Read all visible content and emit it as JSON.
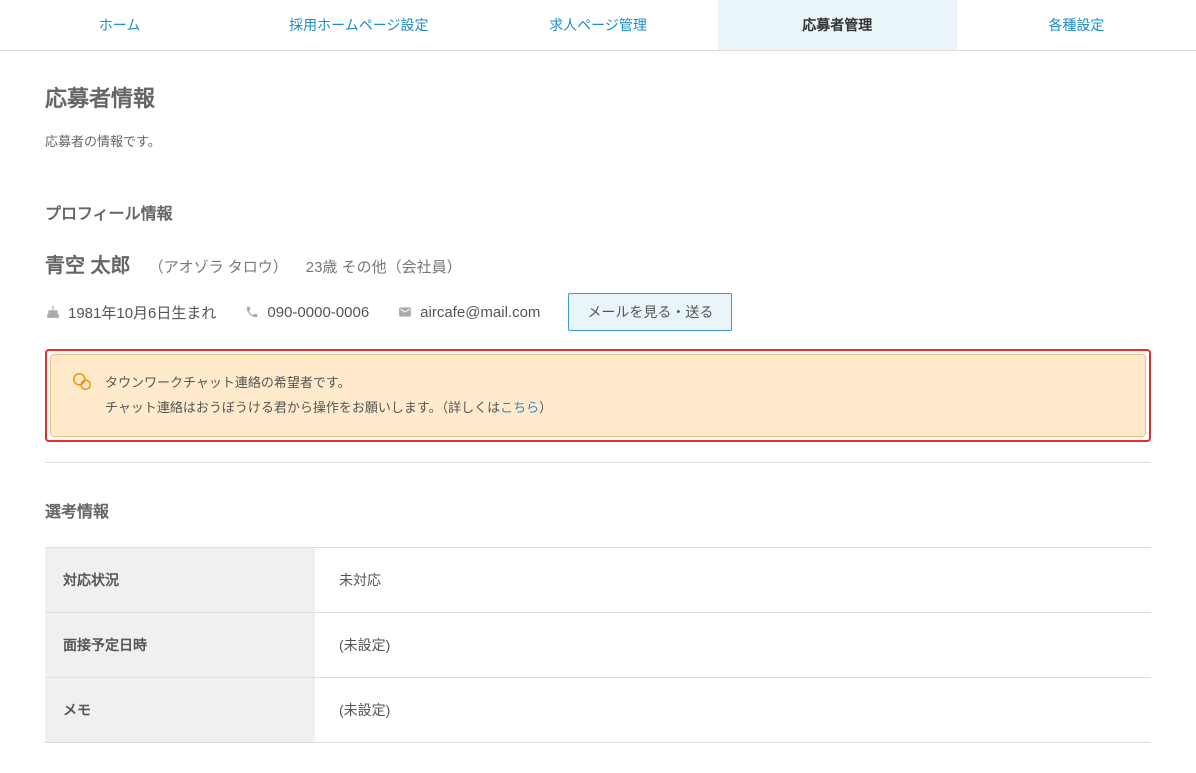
{
  "nav": {
    "items": [
      {
        "label": "ホーム",
        "active": false
      },
      {
        "label": "採用ホームページ設定",
        "active": false
      },
      {
        "label": "求人ページ管理",
        "active": false
      },
      {
        "label": "応募者管理",
        "active": true
      },
      {
        "label": "各種設定",
        "active": false
      }
    ]
  },
  "page": {
    "title": "応募者情報",
    "desc": "応募者の情報です。"
  },
  "profile": {
    "section_title": "プロフィール情報",
    "name": "青空 太郎",
    "kana": "（アオゾラ タロウ）",
    "meta": "23歳 その他（会社員）",
    "birth": "1981年10月6日生まれ",
    "phone": "090-0000-0006",
    "email": "aircafe@mail.com",
    "mail_button": "メールを見る・送る"
  },
  "alert": {
    "line1": "タウンワークチャット連絡の希望者です。",
    "line2_pre": "チャット連絡はおうぼうける君から操作をお願いします。（詳しくは",
    "line2_link": "こちら",
    "line2_post": "）"
  },
  "selection": {
    "section_title": "選考情報",
    "rows": [
      {
        "label": "対応状況",
        "value": "未対応"
      },
      {
        "label": "面接予定日時",
        "value": "(未設定)"
      },
      {
        "label": "メモ",
        "value": "(未設定)"
      }
    ]
  }
}
